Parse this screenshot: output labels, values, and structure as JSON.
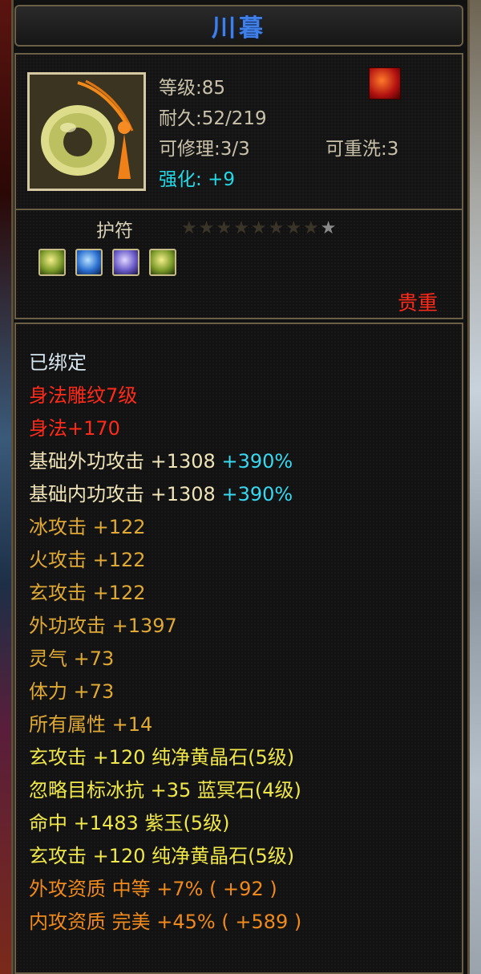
{
  "item": {
    "name": "川暮",
    "level_label": "等级:85",
    "durability_label": "耐久:52/219",
    "repair_label": "可修理:3/3",
    "rewash_label": "可重洗:3",
    "enhance_label": "强化:",
    "enhance_value": "+9",
    "slot_type": "护符",
    "rarity": "贵重",
    "stars": {
      "dim": "★★★★★★★★",
      "lit": "★"
    },
    "gems": [
      "yellow",
      "blue",
      "purple",
      "yellow"
    ]
  },
  "attributes": [
    {
      "text": "已绑定",
      "color": "white"
    },
    {
      "text": "身法雕纹7级",
      "color": "red"
    },
    {
      "text": "身法+170",
      "color": "red"
    },
    {
      "text": "基础外功攻击 +1308",
      "extra": "+390%",
      "color": "cream"
    },
    {
      "text": "基础内功攻击 +1308",
      "extra": "+390%",
      "color": "cream"
    },
    {
      "text": "冰攻击 +122",
      "color": "gold"
    },
    {
      "text": "火攻击 +122",
      "color": "gold"
    },
    {
      "text": "玄攻击 +122",
      "color": "gold"
    },
    {
      "text": "外功攻击 +1397",
      "color": "gold"
    },
    {
      "text": "灵气 +73",
      "color": "gold"
    },
    {
      "text": "体力 +73",
      "color": "gold"
    },
    {
      "text": "所有属性 +14",
      "color": "gold"
    },
    {
      "text": "玄攻击 +120 纯净黄晶石(5级)",
      "color": "yellow"
    },
    {
      "text": "忽略目标冰抗 +35 蓝冥石(4级)",
      "color": "yellow"
    },
    {
      "text": "命中 +1483 紫玉(5级)",
      "color": "yellow"
    },
    {
      "text": "玄攻击 +120 纯净黄晶石(5级)",
      "color": "yellow"
    },
    {
      "text": "外攻资质  中等 +7% ( +92 )",
      "color": "orange"
    },
    {
      "text": "内攻资质  完美 +45% ( +589 )",
      "color": "orange"
    }
  ],
  "colors": {
    "white": "#d8e6ef",
    "red": "#ff2b1a",
    "cream": "#efe3b8",
    "gold": "#e0a934",
    "yellow": "#f0e84a",
    "orange": "#f08a1c",
    "cyan": "#38d8f0"
  }
}
